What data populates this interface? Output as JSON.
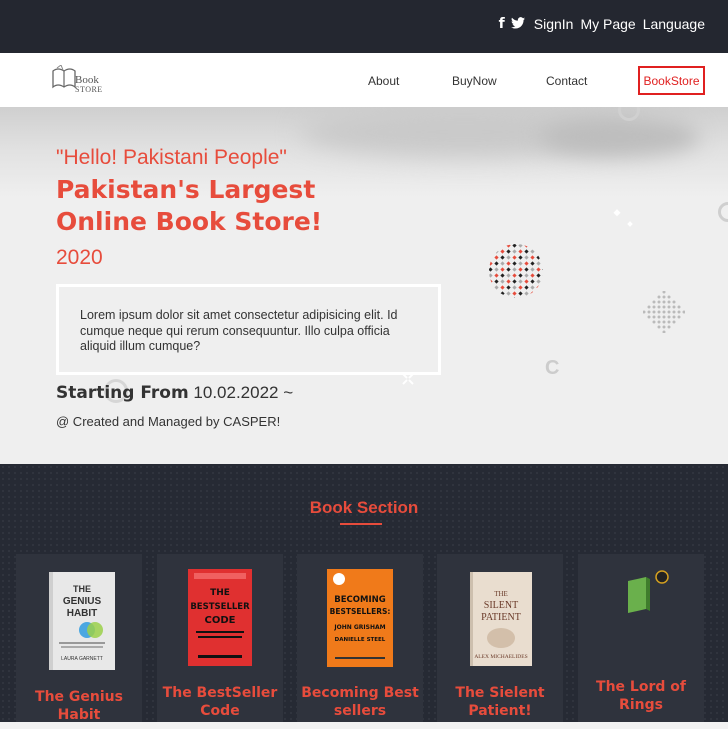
{
  "topbar": {
    "signin": "SignIn",
    "mypage": "My Page",
    "language": "Language",
    "icons": [
      "facebook-icon",
      "twitter-icon"
    ]
  },
  "logo": {
    "line1": "Book",
    "line2": "STORE"
  },
  "nav": {
    "about": "About",
    "buynow": "BuyNow",
    "contact": "Contact",
    "bookstore": "BookStore"
  },
  "hero": {
    "greeting": "\"Hello! Pakistani People\"",
    "headline1": "Pakistan's Largest",
    "headline2": "Online Book Store!",
    "year": "2020",
    "description": "Lorem ipsum dolor sit amet consectetur adipisicing elit. Id cumque neque qui rerum consequuntur. Illo culpa officia aliquid illum cumque?",
    "starting_label": "Starting From",
    "starting_date": "10.02.2022 ~",
    "created": "@ Created and Managed by CASPER!"
  },
  "books": {
    "section_title": "Book Section",
    "items": [
      {
        "title": "The Genius Habit",
        "cover_lines": [
          "THE",
          "GENIUS",
          "HABIT",
          "LAURA GARNETT"
        ]
      },
      {
        "title": "The BestSeller Code",
        "cover_lines": [
          "THE",
          "BESTSELLER",
          "CODE"
        ]
      },
      {
        "title": "Becoming Best sellers",
        "cover_lines": [
          "BECOMING",
          "BESTSELLERS:",
          "JOHN GRISHAM",
          "DANIELLE STEEL"
        ]
      },
      {
        "title": "The Sielent Patient!",
        "cover_lines": [
          "THE",
          "SILENT",
          "PATIENT",
          "ALEX MICHAELIDES"
        ]
      },
      {
        "title": "The Lord of Rings",
        "cover_lines": []
      }
    ]
  },
  "colors": {
    "accent": "#e74c3c",
    "dark": "#242730",
    "card": "#2f333d"
  }
}
